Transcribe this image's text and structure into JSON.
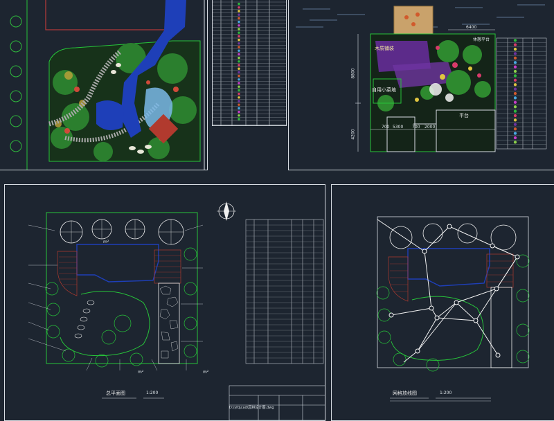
{
  "sheets": {
    "top_right": {
      "area_label_a": "木质铺装",
      "area_label_b": "自用小菜地",
      "area_label_c": "平台",
      "area_label_d": "休憩平台",
      "dim_top": "6400",
      "dim_left_a": "8800",
      "dim_left_b": "4200",
      "dim_bottom_a": "700",
      "dim_bottom_b": "5300",
      "dim_bottom_c": "700",
      "dim_bottom_d": "2000"
    },
    "bottom_left": {
      "title": "总平面图",
      "scale": "1:200",
      "drawing_ref": "D:\\yfq\\cad\\园林设计图.dwg",
      "stamp_a": "m²",
      "stamp_b": "m²",
      "stamp_c": "m²"
    },
    "bottom_right": {
      "title": "网格放线图",
      "scale": "1:200"
    }
  },
  "colors": {
    "background": "#1d2530",
    "frame": "#d8dde3",
    "plant_green": "#27c43a",
    "path_blue": "#1e3fb8",
    "water_magenta": "#c83ec8",
    "deck_red": "#b13a2e",
    "label_yellow": "#f2ea4a"
  }
}
